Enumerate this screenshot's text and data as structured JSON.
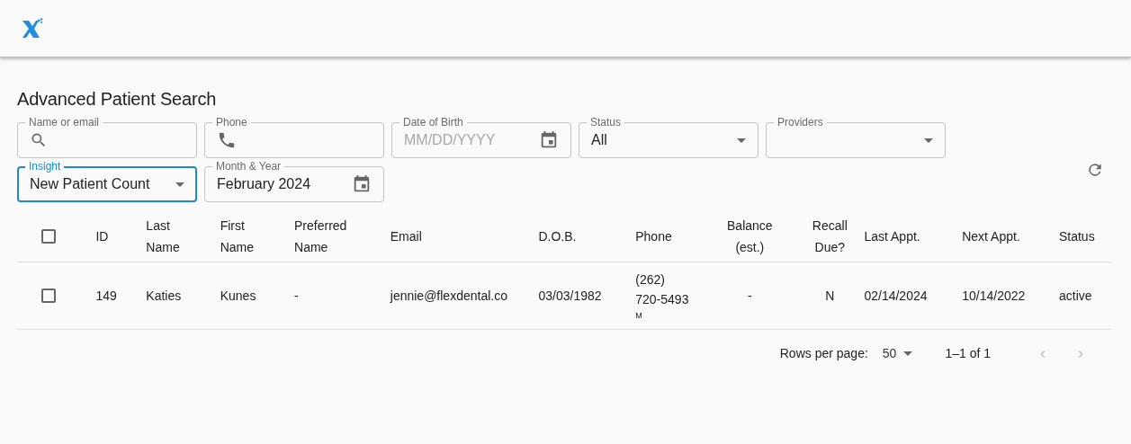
{
  "page_title": "Advanced Patient Search",
  "filters": [
    {
      "kind": "text",
      "label": "Name or email",
      "focused": false
    },
    {
      "kind": "text",
      "label": "Phone",
      "focused": false
    },
    {
      "kind": "date",
      "label": "Date of Birth",
      "placeholder": "MM/DD/YYYY",
      "focused": false
    },
    {
      "kind": "select",
      "label": "Status",
      "value": "All",
      "focused": false
    },
    {
      "kind": "select",
      "label": "Providers",
      "focused": false
    },
    {
      "kind": "select",
      "label": "Insight",
      "value": "New Patient Count",
      "focused": true
    },
    {
      "kind": "date",
      "label": "Month & Year",
      "value": "February 2024",
      "focused": false
    }
  ],
  "table": {
    "select_all_checked": false,
    "columns": [
      "ID",
      "Last Name",
      "First Name",
      "Preferred Name",
      "Email",
      "D.O.B.",
      "Phone",
      "Balance (est.)",
      "Recall Due?",
      "Last Appt.",
      "Next Appt.",
      "Status"
    ],
    "rows": [
      {
        "checked": false,
        "cells": [
          "149",
          "Katies",
          "Kunes",
          "-",
          "jennie@flexdental.co",
          "03/03/1982",
          "(262) 720-5493",
          "-",
          "N",
          "02/14/2024",
          "10/14/2022",
          "active"
        ],
        "phone_type": "M"
      }
    ]
  },
  "pagination": {
    "rows_label": "Rows per page:",
    "rows_value": "50",
    "range": "1–1 of 1",
    "prev_disabled": true,
    "next_disabled": true
  }
}
